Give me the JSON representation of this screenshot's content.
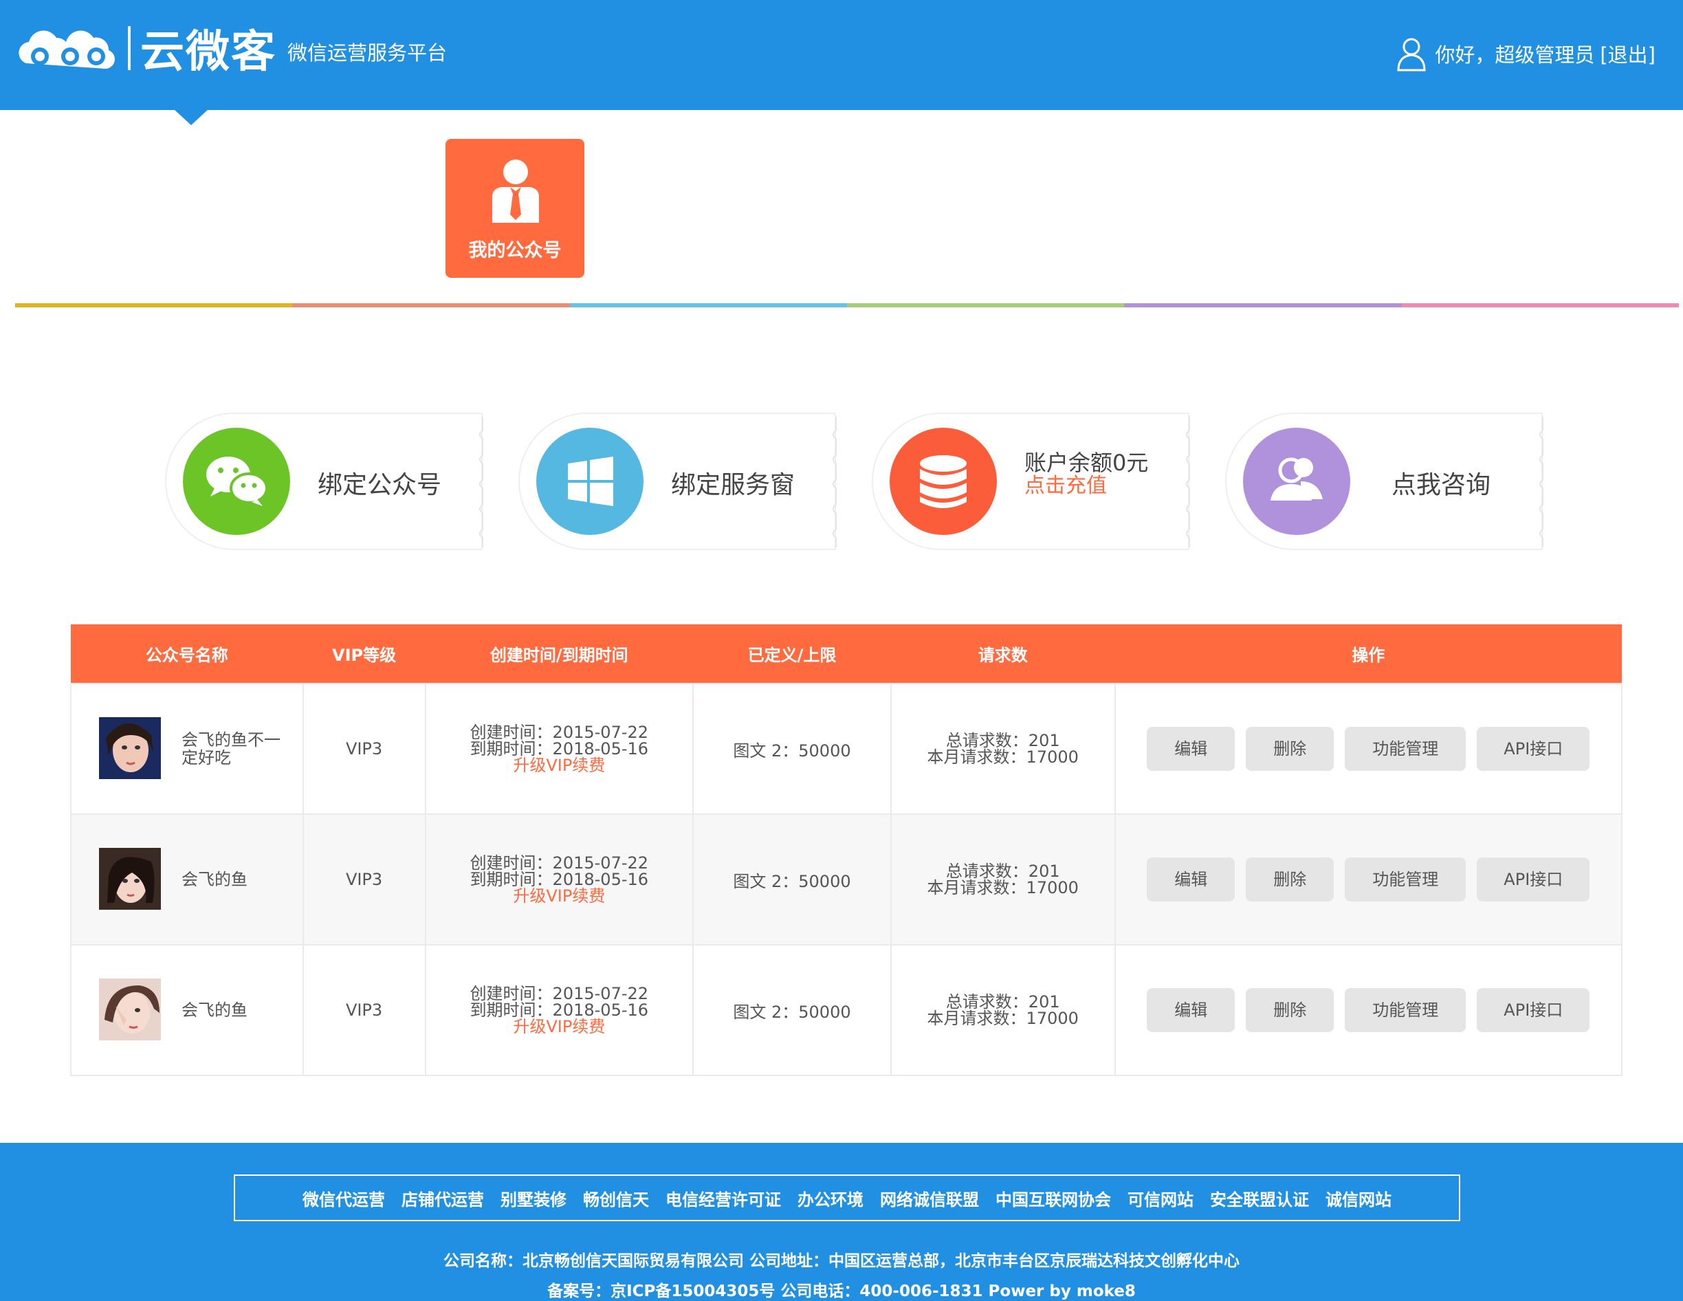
{
  "header": {
    "logo_text": "云微客",
    "subtitle": "微信运营服务平台",
    "greeting": "你好，超级管理员",
    "logout": "[退出]"
  },
  "nav": {
    "tile_label": "我的公众号"
  },
  "color_strip": [
    "#e3b21f",
    "#ef8a73",
    "#65c3e8",
    "#a4cf77",
    "#b390d8",
    "#ee8ab3"
  ],
  "cards": [
    {
      "label": "绑定公众号",
      "color": "#6cc527",
      "icon": "wechat-icon"
    },
    {
      "label": "绑定服务窗",
      "color": "#55b8e0",
      "icon": "windows-icon"
    },
    {
      "label": "账户余额0元",
      "link": "点击充值",
      "color": "#fb5d3b",
      "icon": "database-icon"
    },
    {
      "label": "点我咨询",
      "color": "#b092dc",
      "icon": "users-icon"
    }
  ],
  "table": {
    "headers": [
      "公众号名称",
      "VIP等级",
      "创建时间/到期时间",
      "已定义/上限",
      "请求数",
      "操作"
    ],
    "rows": [
      {
        "name": "会飞的鱼不一定好吃",
        "vip": "VIP3",
        "created": "创建时间：2015-07-22",
        "expires": "到期时间：2018-05-16",
        "upgrade": "升级VIP续费",
        "defined": "图文 2：50000",
        "total_requests": "总请求数：201",
        "month_requests": "本月请求数：17000"
      },
      {
        "name": "会飞的鱼",
        "vip": "VIP3",
        "created": "创建时间：2015-07-22",
        "expires": "到期时间：2018-05-16",
        "upgrade": "升级VIP续费",
        "defined": "图文 2：50000",
        "total_requests": "总请求数：201",
        "month_requests": "本月请求数：17000"
      },
      {
        "name": "会飞的鱼",
        "vip": "VIP3",
        "created": "创建时间：2015-07-22",
        "expires": "到期时间：2018-05-16",
        "upgrade": "升级VIP续费",
        "defined": "图文 2：50000",
        "total_requests": "总请求数：201",
        "month_requests": "本月请求数：17000"
      }
    ],
    "actions": {
      "edit": "编辑",
      "delete": "删除",
      "func": "功能管理",
      "api": "API接口"
    }
  },
  "footer": {
    "links": [
      "微信代运营",
      "店铺代运营",
      "别墅装修",
      "畅创信天",
      "电信经营许可证",
      "办公环境",
      "网络诚信联盟",
      "中国互联网协会",
      "可信网站",
      "安全联盟认证",
      "诚信网站"
    ],
    "company_line": "公司名称：北京畅创信天国际贸易有限公司 公司地址：中国区运营总部，北京市丰台区京辰瑞达科技文创孵化中心",
    "icp_line": "备案号：京ICP备15004305号 公司电话：400-006-1831 Power by moke8"
  },
  "colors": {
    "brand_blue": "#2190e3",
    "accent_orange": "#ff6a3f"
  }
}
